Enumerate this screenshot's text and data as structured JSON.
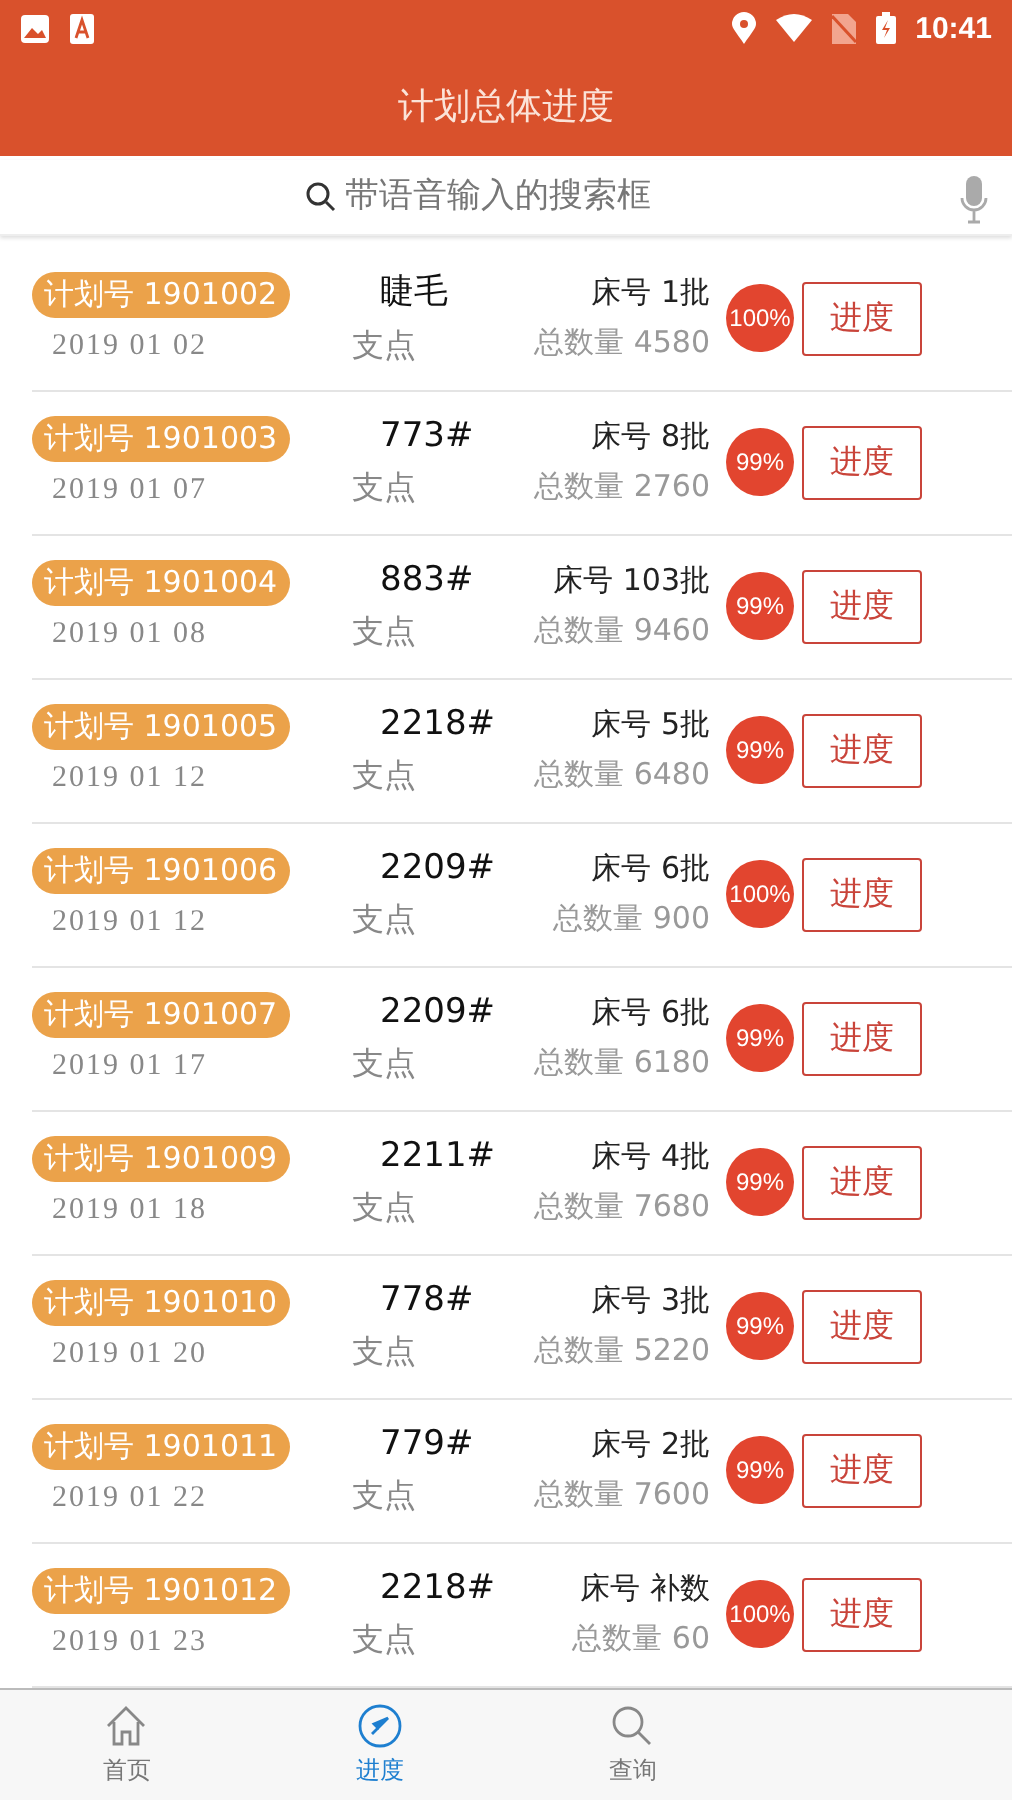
{
  "status_bar": {
    "time": "10:41"
  },
  "header": {
    "title": "计划总体进度"
  },
  "search": {
    "placeholder": "带语音输入的搜索框"
  },
  "rows": [
    {
      "plan": "计划号 1901002",
      "date": "2019 01 02",
      "spec": "睫毛",
      "unit": "支点",
      "bed": "床号 1批",
      "total": "总数量 4580",
      "percent": "100%",
      "button": "进度"
    },
    {
      "plan": "计划号 1901003",
      "date": "2019 01 07",
      "spec": "773#",
      "unit": "支点",
      "bed": "床号 8批",
      "total": "总数量 2760",
      "percent": "99%",
      "button": "进度"
    },
    {
      "plan": "计划号 1901004",
      "date": "2019 01 08",
      "spec": "883#",
      "unit": "支点",
      "bed": "床号 103批",
      "total": "总数量 9460",
      "percent": "99%",
      "button": "进度"
    },
    {
      "plan": "计划号 1901005",
      "date": "2019 01 12",
      "spec": "2218#",
      "unit": "支点",
      "bed": "床号 5批",
      "total": "总数量 6480",
      "percent": "99%",
      "button": "进度"
    },
    {
      "plan": "计划号 1901006",
      "date": "2019 01 12",
      "spec": "2209#",
      "unit": "支点",
      "bed": "床号 6批",
      "total": "总数量 900",
      "percent": "100%",
      "button": "进度"
    },
    {
      "plan": "计划号 1901007",
      "date": "2019 01 17",
      "spec": "2209#",
      "unit": "支点",
      "bed": "床号 6批",
      "total": "总数量 6180",
      "percent": "99%",
      "button": "进度"
    },
    {
      "plan": "计划号 1901009",
      "date": "2019 01 18",
      "spec": "2211#",
      "unit": "支点",
      "bed": "床号 4批",
      "total": "总数量 7680",
      "percent": "99%",
      "button": "进度"
    },
    {
      "plan": "计划号 1901010",
      "date": "2019 01 20",
      "spec": "778#",
      "unit": "支点",
      "bed": "床号 3批",
      "total": "总数量 5220",
      "percent": "99%",
      "button": "进度"
    },
    {
      "plan": "计划号 1901011",
      "date": "2019 01 22",
      "spec": "779#",
      "unit": "支点",
      "bed": "床号 2批",
      "total": "总数量 7600",
      "percent": "99%",
      "button": "进度"
    },
    {
      "plan": "计划号 1901012",
      "date": "2019 01 23",
      "spec": "2218#",
      "unit": "支点",
      "bed": "床号 补数",
      "total": "总数量 60",
      "percent": "100%",
      "button": "进度"
    }
  ],
  "nav": [
    {
      "label": "首页",
      "kind": "home",
      "selected": false
    },
    {
      "label": "进度",
      "kind": "compass",
      "selected": true
    },
    {
      "label": "查询",
      "kind": "search",
      "selected": false
    }
  ]
}
